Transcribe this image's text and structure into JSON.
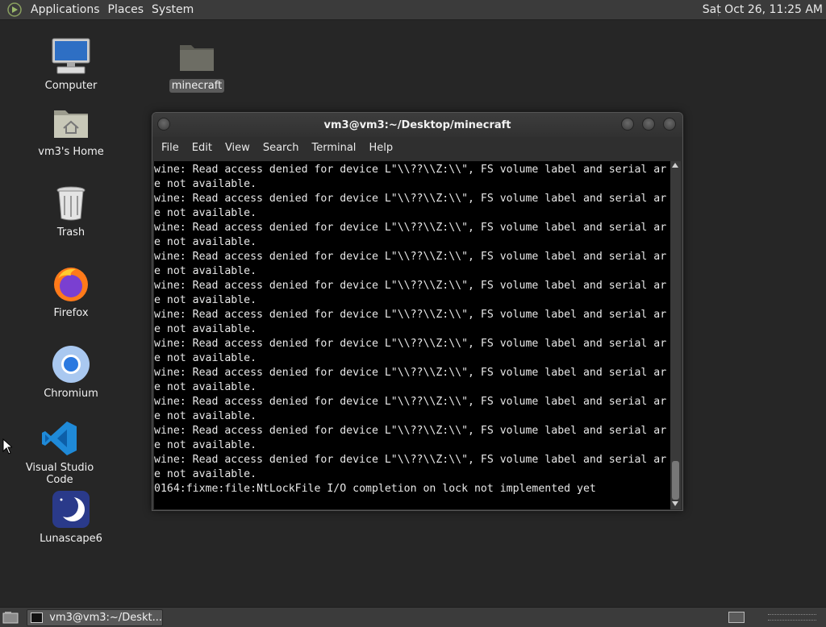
{
  "top_panel": {
    "menu": [
      "Applications",
      "Places",
      "System"
    ],
    "clock": "Sat Oct 26, 11:25 AM"
  },
  "desktop_icons": [
    {
      "label": "Computer",
      "icon": "computer-icon"
    },
    {
      "label": "minecraft",
      "icon": "folder-icon",
      "selected": true
    },
    {
      "label": "vm3's Home",
      "icon": "home-folder-icon"
    },
    {
      "label": "Trash",
      "icon": "trash-icon"
    },
    {
      "label": "Firefox",
      "icon": "firefox-icon"
    },
    {
      "label": "Chromium",
      "icon": "chromium-icon"
    },
    {
      "label": "Visual Studio Code",
      "icon": "vscode-icon"
    },
    {
      "label": "Lunascape6",
      "icon": "lunascape-icon"
    }
  ],
  "terminal": {
    "title": "vm3@vm3:~/Desktop/minecraft",
    "menu": [
      "File",
      "Edit",
      "View",
      "Search",
      "Terminal",
      "Help"
    ],
    "lines": [
      "wine: Read access denied for device L\"\\\\??\\\\Z:\\\\\", FS volume label and serial ar",
      "e not available.",
      "wine: Read access denied for device L\"\\\\??\\\\Z:\\\\\", FS volume label and serial ar",
      "e not available.",
      "wine: Read access denied for device L\"\\\\??\\\\Z:\\\\\", FS volume label and serial ar",
      "e not available.",
      "wine: Read access denied for device L\"\\\\??\\\\Z:\\\\\", FS volume label and serial ar",
      "e not available.",
      "wine: Read access denied for device L\"\\\\??\\\\Z:\\\\\", FS volume label and serial ar",
      "e not available.",
      "wine: Read access denied for device L\"\\\\??\\\\Z:\\\\\", FS volume label and serial ar",
      "e not available.",
      "wine: Read access denied for device L\"\\\\??\\\\Z:\\\\\", FS volume label and serial ar",
      "e not available.",
      "wine: Read access denied for device L\"\\\\??\\\\Z:\\\\\", FS volume label and serial ar",
      "e not available.",
      "wine: Read access denied for device L\"\\\\??\\\\Z:\\\\\", FS volume label and serial ar",
      "e not available.",
      "wine: Read access denied for device L\"\\\\??\\\\Z:\\\\\", FS volume label and serial ar",
      "e not available.",
      "wine: Read access denied for device L\"\\\\??\\\\Z:\\\\\", FS volume label and serial ar",
      "e not available.",
      "0164:fixme:file:NtLockFile I/O completion on lock not implemented yet"
    ]
  },
  "bottom_panel": {
    "task_label": "vm3@vm3:~/Deskt..."
  }
}
